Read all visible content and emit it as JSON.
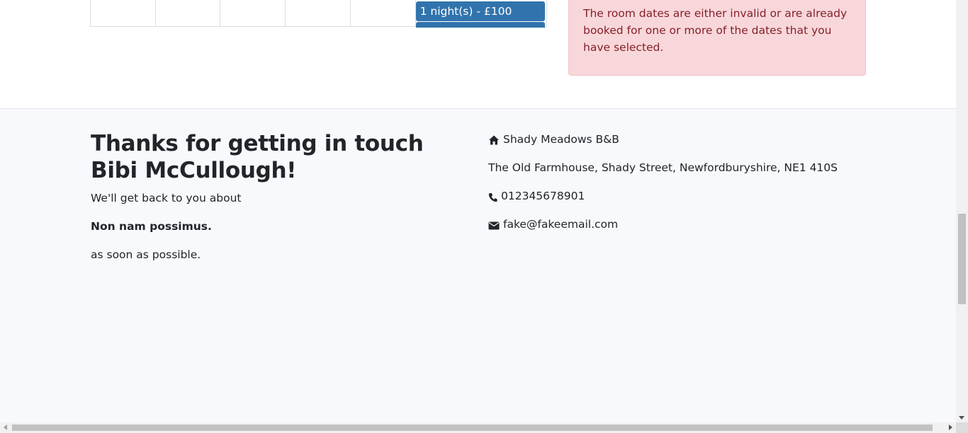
{
  "calendar": {
    "event_label": "1 night(s) - £100"
  },
  "alert": {
    "message": "The room dates are either invalid or are already booked for one or more of the dates that you have selected."
  },
  "thanks": {
    "heading": "Thanks for getting in touch Bibi McCullough!",
    "line1": "We'll get back to you about",
    "subject": "Non nam possimus.",
    "line2": "as soon as possible."
  },
  "contact_info": {
    "name": "Shady Meadows B&B",
    "address": "The Old Farmhouse, Shady Street, Newfordburyshire, NE1 410S",
    "phone": "012345678901",
    "email": "fake@fakeemail.com",
    "icons": [
      "home-icon",
      "phone-icon",
      "envelope-icon"
    ]
  },
  "colors": {
    "event": "#3174ad",
    "alert_bg": "#f8d7da",
    "alert_text": "#842029",
    "footer_bg": "#f7f9fc"
  }
}
